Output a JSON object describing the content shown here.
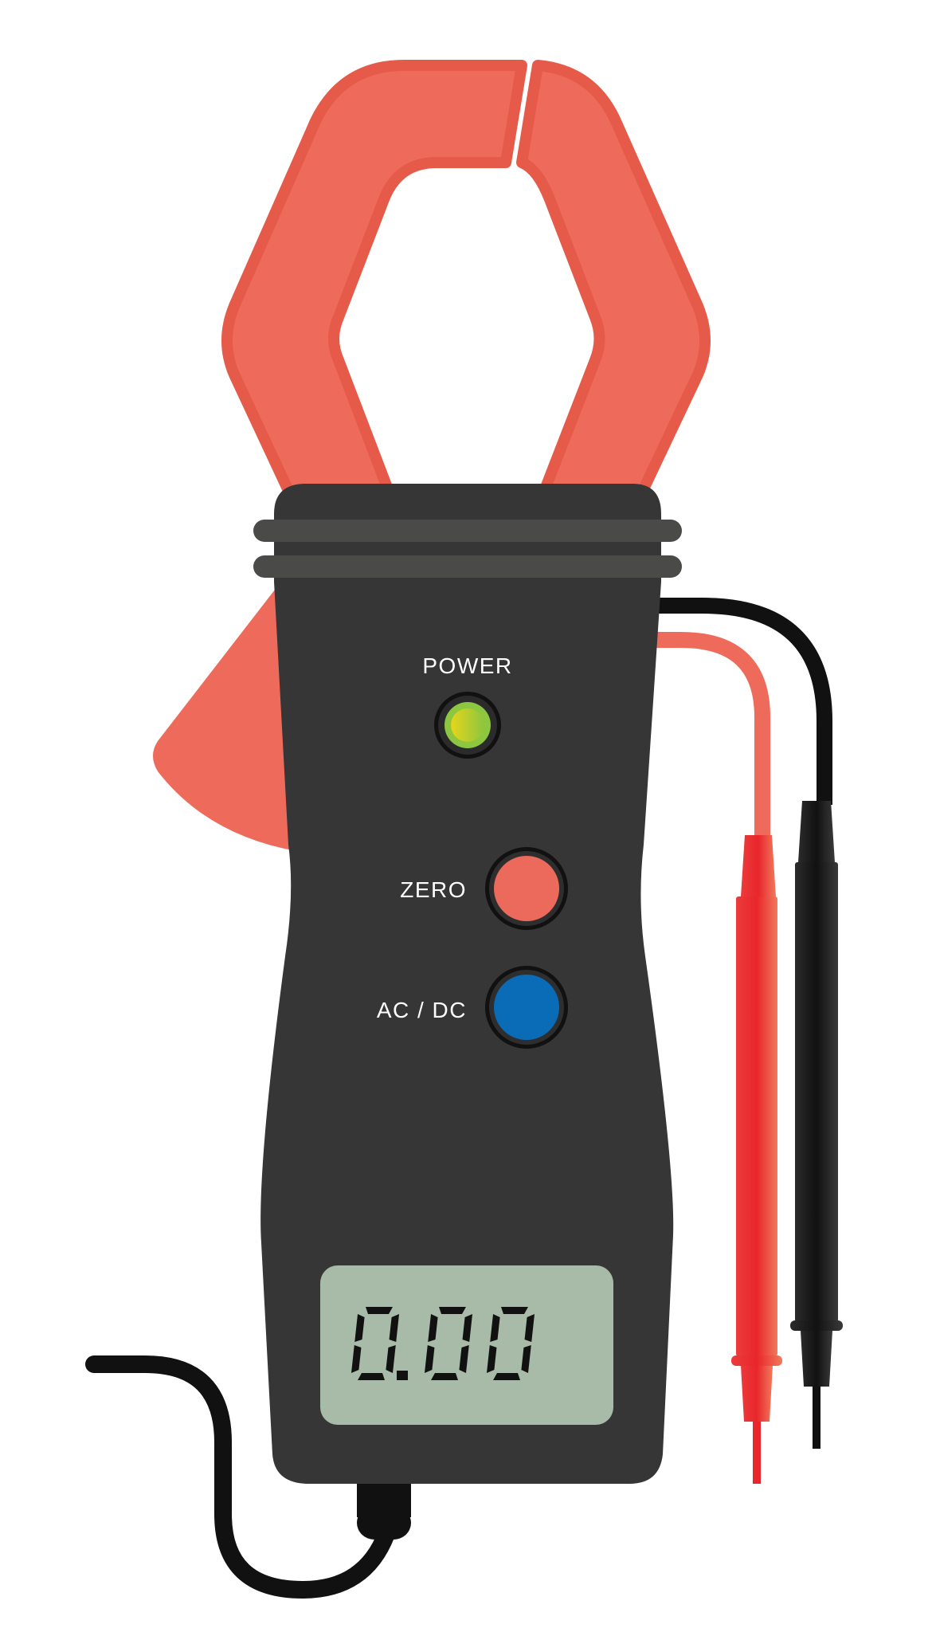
{
  "device": {
    "power_label": "POWER",
    "zero_label": "ZERO",
    "acdc_label": "AC / DC",
    "display_value": "0.00",
    "power_led_on": true
  },
  "colors": {
    "body": "#363636",
    "band": "#4a4a49",
    "jaw_fill": "#ee6b5b",
    "jaw_stroke": "#e55a48",
    "lcd": "#a8bba8",
    "lcd_digit": "#111111",
    "zero_button": "#ec6a5b",
    "acdc_button": "#0a6cb7",
    "led": "#a7c927",
    "probe_red": "#e8262c",
    "probe_black": "#1a1a1a",
    "wire_red": "#ee6b5b",
    "wire_black": "#111111"
  },
  "icons": {
    "power_led": "led-indicator-icon",
    "zero_button": "circle-button-icon",
    "acdc_button": "circle-button-icon",
    "red_probe": "test-probe-icon",
    "black_probe": "test-probe-icon",
    "clamp_jaw": "clamp-jaw-icon"
  }
}
